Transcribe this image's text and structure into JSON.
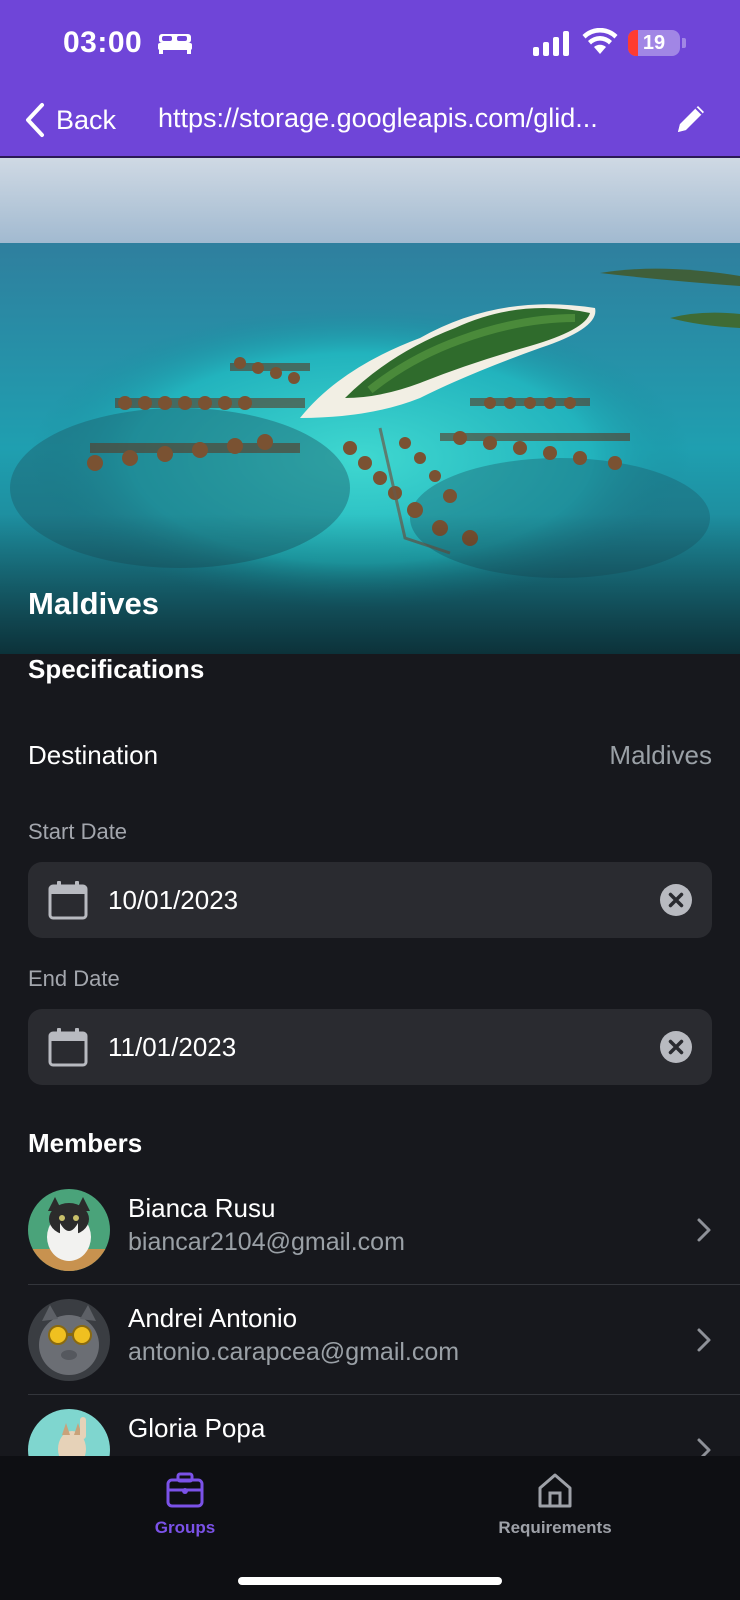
{
  "status_bar": {
    "time": "03:00",
    "battery_level": "19",
    "battery_fraction": 0.19,
    "icons": [
      "bed-icon",
      "signal-icon",
      "wifi-icon",
      "battery-icon"
    ]
  },
  "nav": {
    "back_label": "Back",
    "title": "https://storage.googleapis.com/glid...",
    "edit_icon": "pencil-icon"
  },
  "hero": {
    "title": "Maldives"
  },
  "specifications": {
    "heading": "Specifications",
    "destination_label": "Destination",
    "destination_value": "Maldives",
    "start_date_label": "Start Date",
    "start_date_value": "10/01/2023",
    "end_date_label": "End Date",
    "end_date_value": "11/01/2023"
  },
  "members": {
    "heading": "Members",
    "items": [
      {
        "name": "Bianca Rusu",
        "email": "biancar2104@gmail.com"
      },
      {
        "name": "Andrei Antonio",
        "email": "antonio.carapcea@gmail.com"
      },
      {
        "name": "Gloria Popa",
        "email": ""
      }
    ]
  },
  "tabbar": {
    "groups_label": "Groups",
    "requirements_label": "Requirements",
    "active_tab": "Groups"
  },
  "colors": {
    "accent": "#6f45d8",
    "active_tab": "#7b52e8",
    "background": "#17181d",
    "field_background": "#2a2b30"
  }
}
